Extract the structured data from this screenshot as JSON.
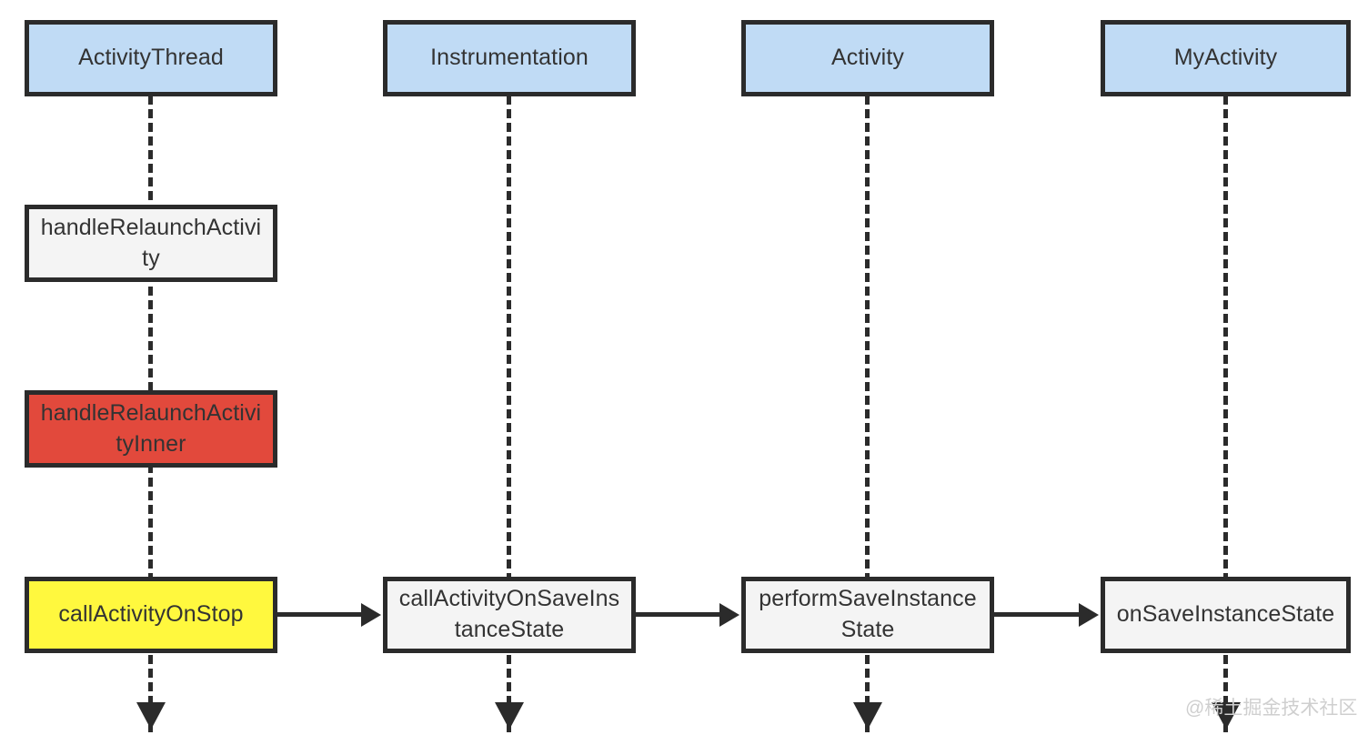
{
  "diagram": {
    "type": "uml-sequence-diagram",
    "background": "#ffffff",
    "colors": {
      "participant_fill": "#c0dbf5",
      "step_fill": "#f4f4f4",
      "highlight_red_fill": "#e2493c",
      "highlight_yellow_fill": "#fff83e",
      "stroke": "#2b2b2b",
      "text": "#333333",
      "watermark": "#cfcfcf"
    },
    "participants": [
      {
        "id": "activity-thread",
        "label": "ActivityThread"
      },
      {
        "id": "instrumentation",
        "label": "Instrumentation"
      },
      {
        "id": "activity",
        "label": "Activity"
      },
      {
        "id": "my-activity",
        "label": "MyActivity"
      }
    ],
    "steps": [
      {
        "id": "handle-relaunch-activity",
        "label": "handleRelaunchActivity",
        "lane": "activity-thread",
        "style": "plain"
      },
      {
        "id": "handle-relaunch-activity-inner",
        "label": "handleRelaunchActivityInner",
        "lane": "activity-thread",
        "style": "danger"
      },
      {
        "id": "call-activity-on-stop",
        "label": "callActivityOnStop",
        "lane": "activity-thread",
        "style": "warn"
      },
      {
        "id": "call-activity-on-save-instance-state",
        "label": "callActivityOnSaveInstanceState",
        "lane": "instrumentation",
        "style": "plain"
      },
      {
        "id": "perform-save-instance-state",
        "label": "performSaveInstanceState",
        "lane": "activity",
        "style": "plain"
      },
      {
        "id": "on-save-instance-state",
        "label": "onSaveInstanceState",
        "lane": "my-activity",
        "style": "plain"
      }
    ],
    "messages": [
      {
        "id": "msg-stop-to-save",
        "from": "call-activity-on-stop",
        "to": "call-activity-on-save-instance-state"
      },
      {
        "id": "msg-save-to-perform",
        "from": "call-activity-on-save-instance-state",
        "to": "perform-save-instance-state"
      },
      {
        "id": "msg-perform-to-onsave",
        "from": "perform-save-instance-state",
        "to": "on-save-instance-state"
      }
    ],
    "watermark": "@稀土掘金技术社区"
  }
}
